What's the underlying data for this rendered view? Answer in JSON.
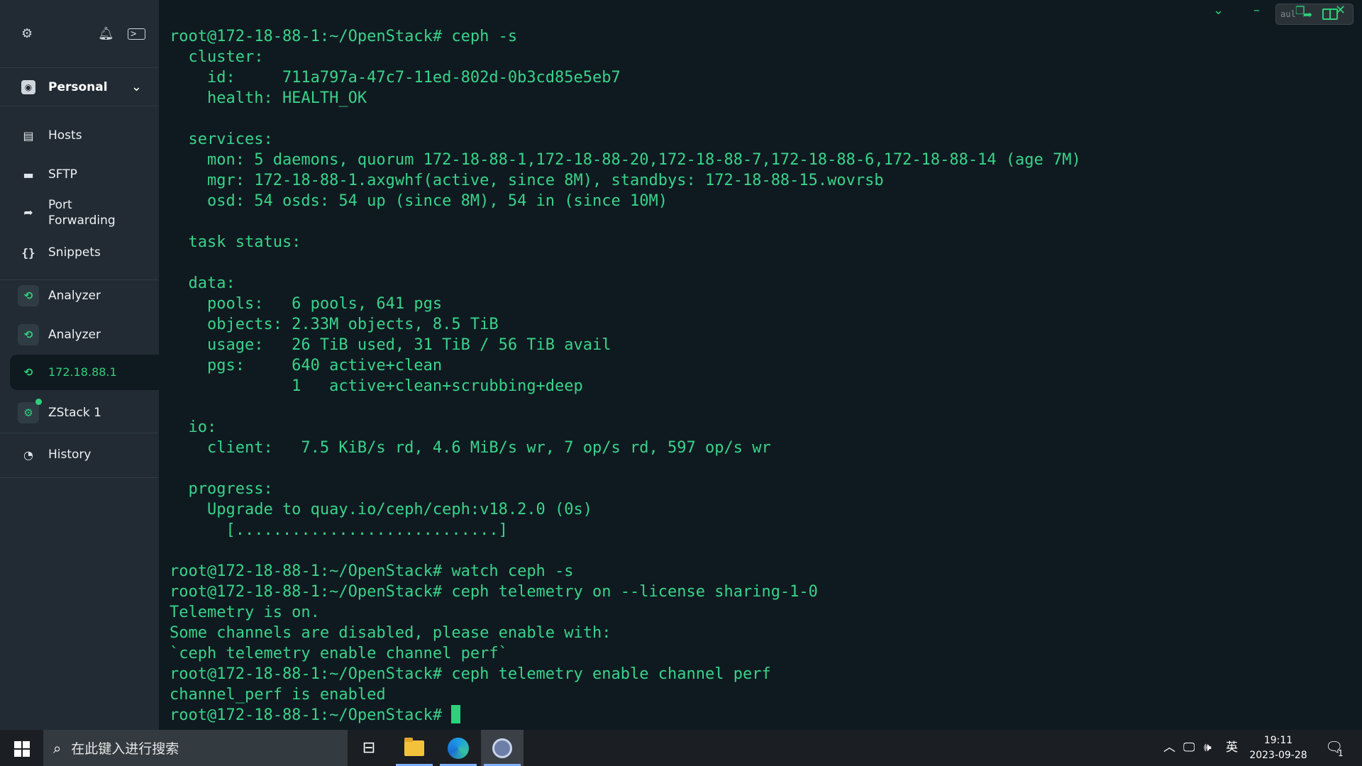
{
  "sidebar": {
    "vault": {
      "label": "Personal"
    },
    "items": [
      {
        "label": "Hosts",
        "icon": "hosts-icon"
      },
      {
        "label": "SFTP",
        "icon": "folder-icon"
      },
      {
        "label": "Port\nForwarding",
        "icon": "port-forwarding-icon"
      },
      {
        "label": "Snippets",
        "icon": "snippets-icon"
      }
    ],
    "tabs": [
      {
        "label": "Analyzer"
      },
      {
        "label": "Analyzer"
      },
      {
        "label": "172.18.88.1"
      },
      {
        "label": "ZStack 1"
      }
    ],
    "history": {
      "label": "History"
    }
  },
  "terminal": {
    "lines": [
      "root@172-18-88-1:~/OpenStack# ceph -s",
      "  cluster:",
      "    id:     711a797a-47c7-11ed-802d-0b3cd85e5eb7",
      "    health: HEALTH_OK",
      "",
      "  services:",
      "    mon: 5 daemons, quorum 172-18-88-1,172-18-88-20,172-18-88-7,172-18-88-6,172-18-88-14 (age 7M)",
      "    mgr: 172-18-88-1.axgwhf(active, since 8M), standbys: 172-18-88-15.wovrsb",
      "    osd: 54 osds: 54 up (since 8M), 54 in (since 10M)",
      "",
      "  task status:",
      "",
      "  data:",
      "    pools:   6 pools, 641 pgs",
      "    objects: 2.33M objects, 8.5 TiB",
      "    usage:   26 TiB used, 31 TiB / 56 TiB avail",
      "    pgs:     640 active+clean",
      "             1   active+clean+scrubbing+deep",
      "",
      "  io:",
      "    client:   7.5 KiB/s rd, 4.6 MiB/s wr, 7 op/s rd, 597 op/s wr",
      "",
      "  progress:",
      "    Upgrade to quay.io/ceph/ceph:v18.2.0 (0s)",
      "      [............................]",
      "",
      "root@172-18-88-1:~/OpenStack# watch ceph -s",
      "root@172-18-88-1:~/OpenStack# ceph telemetry on --license sharing-1-0",
      "Telemetry is on.",
      "Some channels are disabled, please enable with:",
      "`ceph telemetry enable channel perf`",
      "root@172-18-88-1:~/OpenStack# ceph telemetry enable channel perf",
      "channel_perf is enabled"
    ],
    "prompt": "root@172-18-88-1:~/OpenStack# "
  },
  "toolbar": {
    "pill_text": "aul"
  },
  "taskbar": {
    "search_placeholder": "在此键入进行搜索",
    "ime": "英",
    "time": "19:11",
    "date": "2023-09-28",
    "notification_count": "1"
  },
  "colors": {
    "terminal_text": "#3ad38a",
    "terminal_bg": "#0f1a20",
    "sidebar_bg": "#222b33",
    "accent": "#2fd07a"
  }
}
